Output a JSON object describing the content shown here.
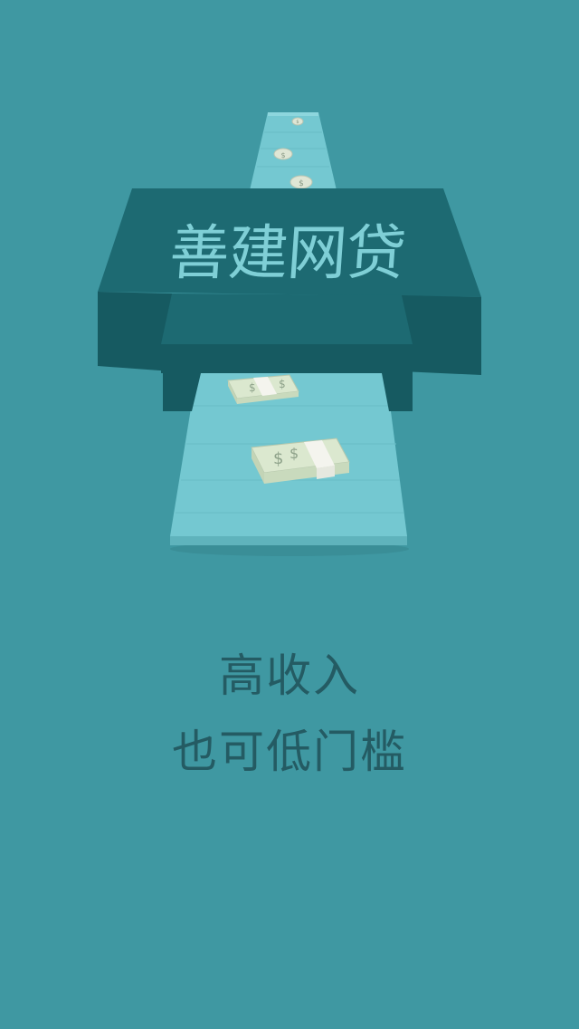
{
  "brand": {
    "title": "善建网贷"
  },
  "slide": {
    "line1": "高收入",
    "line2": "也可低门槛"
  },
  "icons": {
    "coin": "coin-icon",
    "cash": "cash-bundle-icon",
    "machine": "money-printer-machine"
  },
  "colors": {
    "background": "#3f98a2",
    "machine_top": "#1d6a72",
    "machine_side": "#165a61",
    "belt": "#74c8d1",
    "title_text": "#7fcfd6",
    "tagline_text": "#245b63"
  }
}
